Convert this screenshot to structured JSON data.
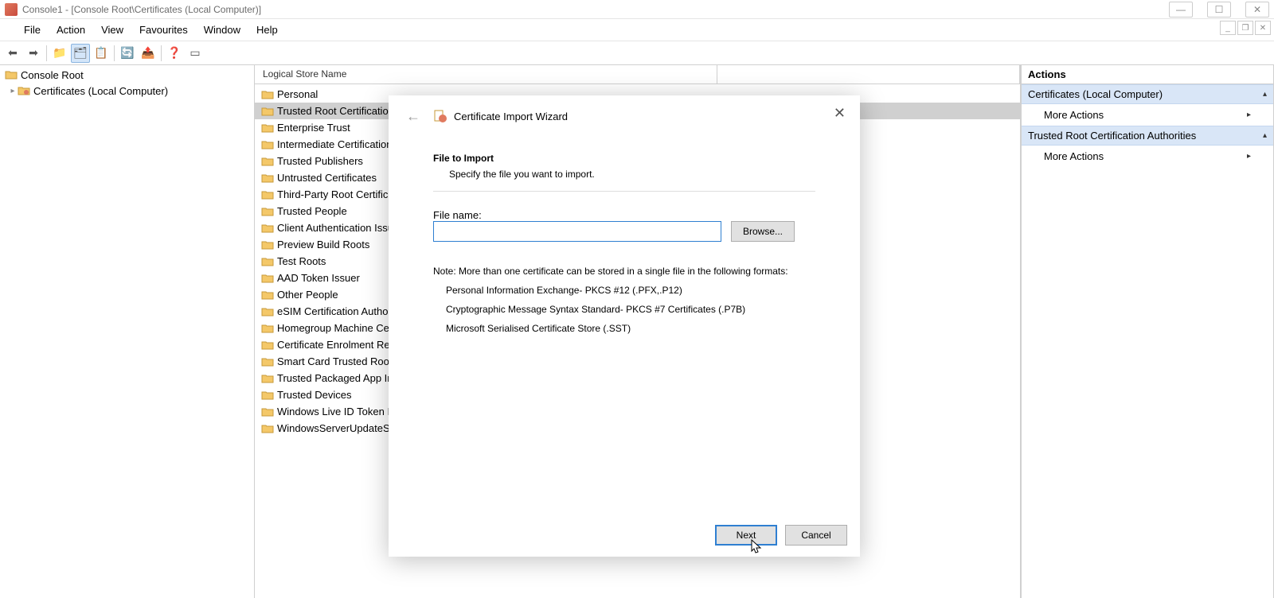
{
  "window": {
    "title": "Console1 - [Console Root\\Certificates (Local Computer)]"
  },
  "menu": {
    "items": [
      "File",
      "Action",
      "View",
      "Favourites",
      "Window",
      "Help"
    ]
  },
  "tree": {
    "root": "Console Root",
    "child": "Certificates (Local Computer)"
  },
  "center": {
    "column_header": "Logical Store Name",
    "stores": [
      "Personal",
      "Trusted Root Certification Authorities",
      "Enterprise Trust",
      "Intermediate Certification Authorities",
      "Trusted Publishers",
      "Untrusted Certificates",
      "Third-Party Root Certification Authorities",
      "Trusted People",
      "Client Authentication Issuers",
      "Preview Build Roots",
      "Test Roots",
      "AAD Token Issuer",
      "Other People",
      "eSIM Certification Authorities",
      "Homegroup Machine Certificates",
      "Certificate Enrolment Requests",
      "Smart Card Trusted Roots",
      "Trusted Packaged App Installation Authorities",
      "Trusted Devices",
      "Windows Live ID Token Issuer",
      "WindowsServerUpdateServices"
    ],
    "selected_index": 1
  },
  "actions": {
    "header": "Actions",
    "group1": "Certificates (Local Computer)",
    "group1_more": "More Actions",
    "group2": "Trusted Root Certification Authorities",
    "group2_more": "More Actions"
  },
  "dialog": {
    "wizard_title": "Certificate Import Wizard",
    "section_title": "File to Import",
    "section_subtitle": "Specify the file you want to import.",
    "file_label": "File name:",
    "file_value": "",
    "browse": "Browse...",
    "note_header": "Note:  More than one certificate can be stored in a single file in the following formats:",
    "note1": "Personal Information Exchange- PKCS #12 (.PFX,.P12)",
    "note2": "Cryptographic Message Syntax Standard- PKCS #7 Certificates (.P7B)",
    "note3": "Microsoft Serialised Certificate Store (.SST)",
    "next": "Next",
    "cancel": "Cancel"
  }
}
